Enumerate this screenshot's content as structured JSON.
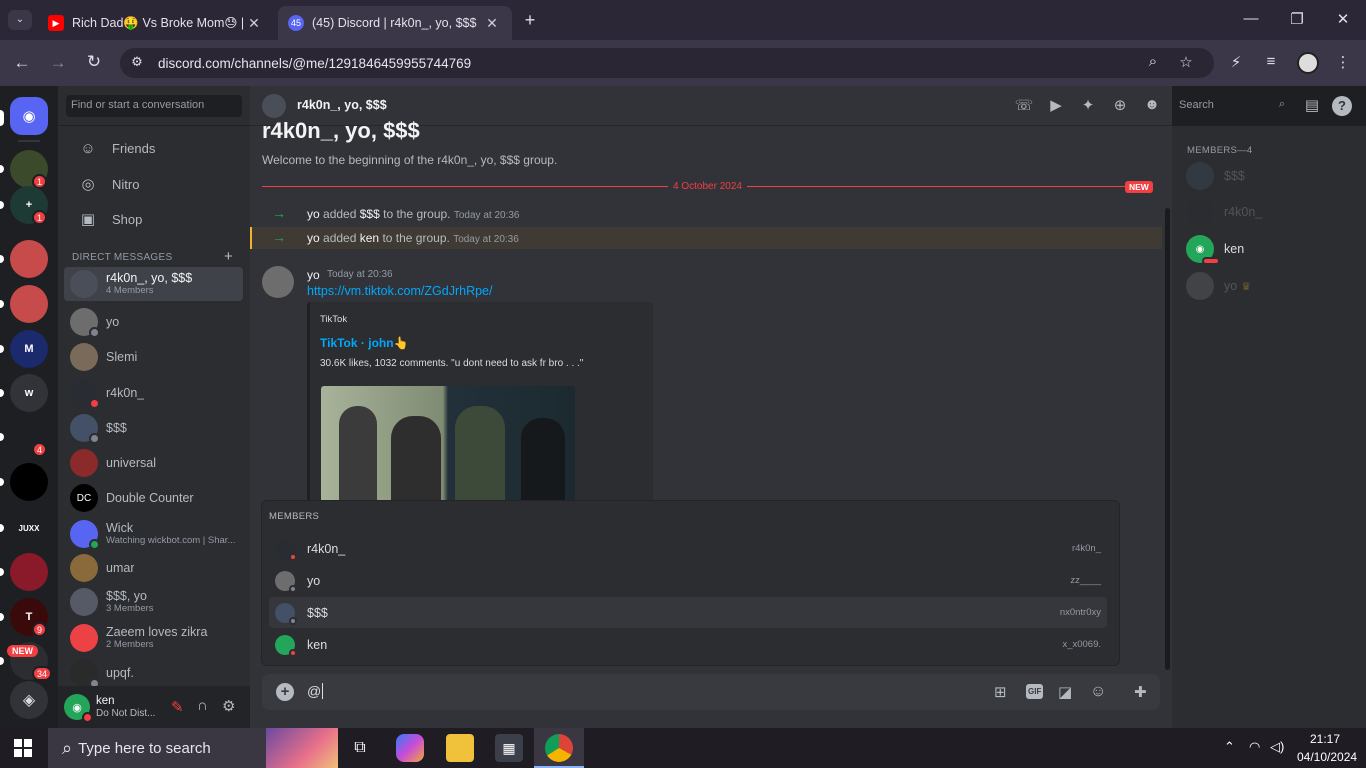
{
  "browser": {
    "tabs": [
      {
        "title": "Rich Dad🤑 Vs Broke Mom😓 |",
        "favicon": "youtube-icon"
      },
      {
        "title": "(45) Discord | r4k0n_, yo, $$$",
        "favicon": "discord-icon",
        "badge": "45"
      }
    ],
    "url": "discord.com/channels/@me/1291846459955744769",
    "window": {
      "minimize": "—",
      "restore": "❐",
      "close": "✕"
    }
  },
  "guilds": [
    {
      "label": "",
      "badge": "1",
      "color": "#3a4a2a",
      "icon": "turtle-icon"
    },
    {
      "label": "+",
      "badge": "1",
      "color": "#1e3a35",
      "icon": "add-server-icon"
    },
    {
      "label": "",
      "badge": "",
      "color": "#c84b4b",
      "icon": "server-avatar-icon"
    },
    {
      "label": "",
      "badge": "",
      "color": "#c84b4b",
      "icon": "server-avatar-icon"
    },
    {
      "label": "M",
      "badge": "",
      "color": "#1a2a6c",
      "icon": "server-m-icon"
    },
    {
      "label": "w",
      "badge": "",
      "color": "#313338",
      "icon": "server-w-icon"
    },
    {
      "label": "",
      "badge": "4",
      "color": "#1e1f22",
      "icon": "server-figure-icon"
    },
    {
      "label": "",
      "badge": "",
      "color": "#000000",
      "icon": "server-eye-icon"
    },
    {
      "label": "JUXX",
      "badge": "",
      "color": "#1e1f22",
      "icon": "server-juxx-icon"
    },
    {
      "label": "",
      "badge": "",
      "color": "#8a1a2a",
      "icon": "server-red-icon"
    },
    {
      "label": "T",
      "badge": "9",
      "color": "#3a0a0a",
      "icon": "server-t-icon"
    },
    {
      "label": "",
      "badge": "34",
      "color": "#2b2d31",
      "icon": "server-new-icon"
    }
  ],
  "guild_new_label": "NEW",
  "search_conv": "Find or start a conversation",
  "nav": [
    {
      "label": "Friends",
      "icon": "friends-icon"
    },
    {
      "label": "Nitro",
      "icon": "nitro-icon"
    },
    {
      "label": "Shop",
      "icon": "shop-icon"
    }
  ],
  "dm_header": "DIRECT MESSAGES",
  "dm_add": "+",
  "dms": [
    {
      "name": "r4k0n_, yo, $$$",
      "sub": "4 Members",
      "color": "#4a4e58",
      "status": "",
      "active": true
    },
    {
      "name": "yo",
      "sub": "",
      "color": "#6d6d6d",
      "status": "#80848e"
    },
    {
      "name": "Slemi",
      "sub": "",
      "color": "#7a6a5a",
      "status": ""
    },
    {
      "name": "r4k0n_",
      "sub": "",
      "color": "#2a2c33",
      "status": "#f23f43"
    },
    {
      "name": "$$$",
      "sub": "",
      "color": "#445066",
      "status": "#80848e"
    },
    {
      "name": "universal",
      "sub": "",
      "color": "#8a2a2a",
      "status": ""
    },
    {
      "name": "Double Counter",
      "sub": "",
      "color": "#000000",
      "status": "",
      "initials": "DC"
    },
    {
      "name": "Wick",
      "sub": "Watching wickbot.com | Shar...",
      "color": "#5865f2",
      "status": "#23a55a"
    },
    {
      "name": "umar",
      "sub": "",
      "color": "#8a6a3a",
      "status": ""
    },
    {
      "name": "$$$, yo",
      "sub": "3 Members",
      "color": "#555a66",
      "status": ""
    },
    {
      "name": "Zaeem loves zikra",
      "sub": "2 Members",
      "color": "#ed4245",
      "status": ""
    },
    {
      "name": "upqf.",
      "sub": "",
      "color": "#2a2a2a",
      "status": "#80848e"
    }
  ],
  "user": {
    "name": "ken",
    "status": "Do Not Dist..."
  },
  "channel": {
    "name": "r4k0n_, yo, $$$",
    "big_title": "r4k0n_, yo, $$$",
    "welcome": "Welcome to the beginning of the r4k0n_, yo, $$$ group.",
    "date_divider": "4 October 2024",
    "new_label": "NEW",
    "search_placeholder": "Search"
  },
  "system_msgs": [
    {
      "actor": "yo",
      "text1": "added",
      "target": "$$$",
      "text2": "to the group.",
      "time": "Today at 20:36"
    },
    {
      "actor": "yo",
      "text1": "added",
      "target": "ken",
      "text2": "to the group.",
      "time": "Today at 20:36"
    }
  ],
  "message": {
    "author": "yo",
    "time": "Today at 20:36",
    "link": "https://vm.tiktok.com/ZGdJrhRpe/",
    "embed": {
      "provider": "TikTok",
      "title": "TikTok · john👆",
      "desc": "30.6K likes, 1032 comments. \"u dont need to ask fr bro . . .\""
    }
  },
  "members_header": "MEMBERS—4",
  "members": [
    {
      "name": "$$$",
      "color": "#445066",
      "faded": true
    },
    {
      "name": "r4k0n_",
      "color": "#2a2c33",
      "faded": true
    },
    {
      "name": "ken",
      "color": "#23a55a",
      "faded": false
    },
    {
      "name": "yo",
      "color": "#6d6d6d",
      "faded": true,
      "crown": "♛"
    }
  ],
  "popup": {
    "header": "MEMBERS",
    "rows": [
      {
        "name": "r4k0n_",
        "username": "r4k0n_",
        "color": "#2a2c33",
        "status": "#f23f43"
      },
      {
        "name": "yo",
        "username": "zz____",
        "color": "#6d6d6d",
        "status": "#80848e"
      },
      {
        "name": "$$$",
        "username": "nx0ntr0xy",
        "color": "#445066",
        "status": "#80848e",
        "selected": true
      },
      {
        "name": "ken",
        "username": "x_x0069.",
        "color": "#23a55a",
        "status": "#f23f43"
      }
    ]
  },
  "composer_text": "@",
  "taskbar": {
    "search": "Type here to search",
    "time": "21:17",
    "date": "04/10/2024"
  }
}
